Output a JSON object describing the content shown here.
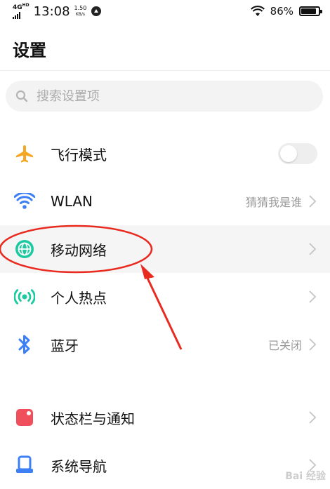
{
  "status_bar": {
    "network": "4G",
    "network_sup": "HD",
    "time": "13:08",
    "speed_value": "1.50",
    "speed_unit": "KB/s",
    "battery_text": "86%",
    "battery_level": 0.86
  },
  "page": {
    "title": "设置"
  },
  "search": {
    "placeholder": "搜索设置项"
  },
  "items": [
    {
      "label": "飞行模式",
      "icon": "airplane-icon",
      "control": "toggle",
      "toggle_on": false
    },
    {
      "label": "WLAN",
      "icon": "wifi-icon",
      "value": "猜猜我是谁"
    },
    {
      "label": "移动网络",
      "icon": "globe-icon",
      "highlighted": true
    },
    {
      "label": "个人热点",
      "icon": "hotspot-icon"
    },
    {
      "label": "蓝牙",
      "icon": "bluetooth-icon",
      "value": "已关闭"
    },
    {
      "label": "状态栏与通知",
      "icon": "notification-icon"
    },
    {
      "label": "系统导航",
      "icon": "navigation-icon"
    }
  ],
  "watermark": {
    "text": "Bai 经验"
  },
  "colors": {
    "airplane": "#f5a623",
    "wifi": "#3d7ff5",
    "globe": "#1dc9a0",
    "hotspot": "#1dc9a0",
    "bluetooth": "#3d7ff5",
    "notification": "#f0505c",
    "navigation": "#3d7ff5",
    "annotation": "#e82a1f"
  }
}
